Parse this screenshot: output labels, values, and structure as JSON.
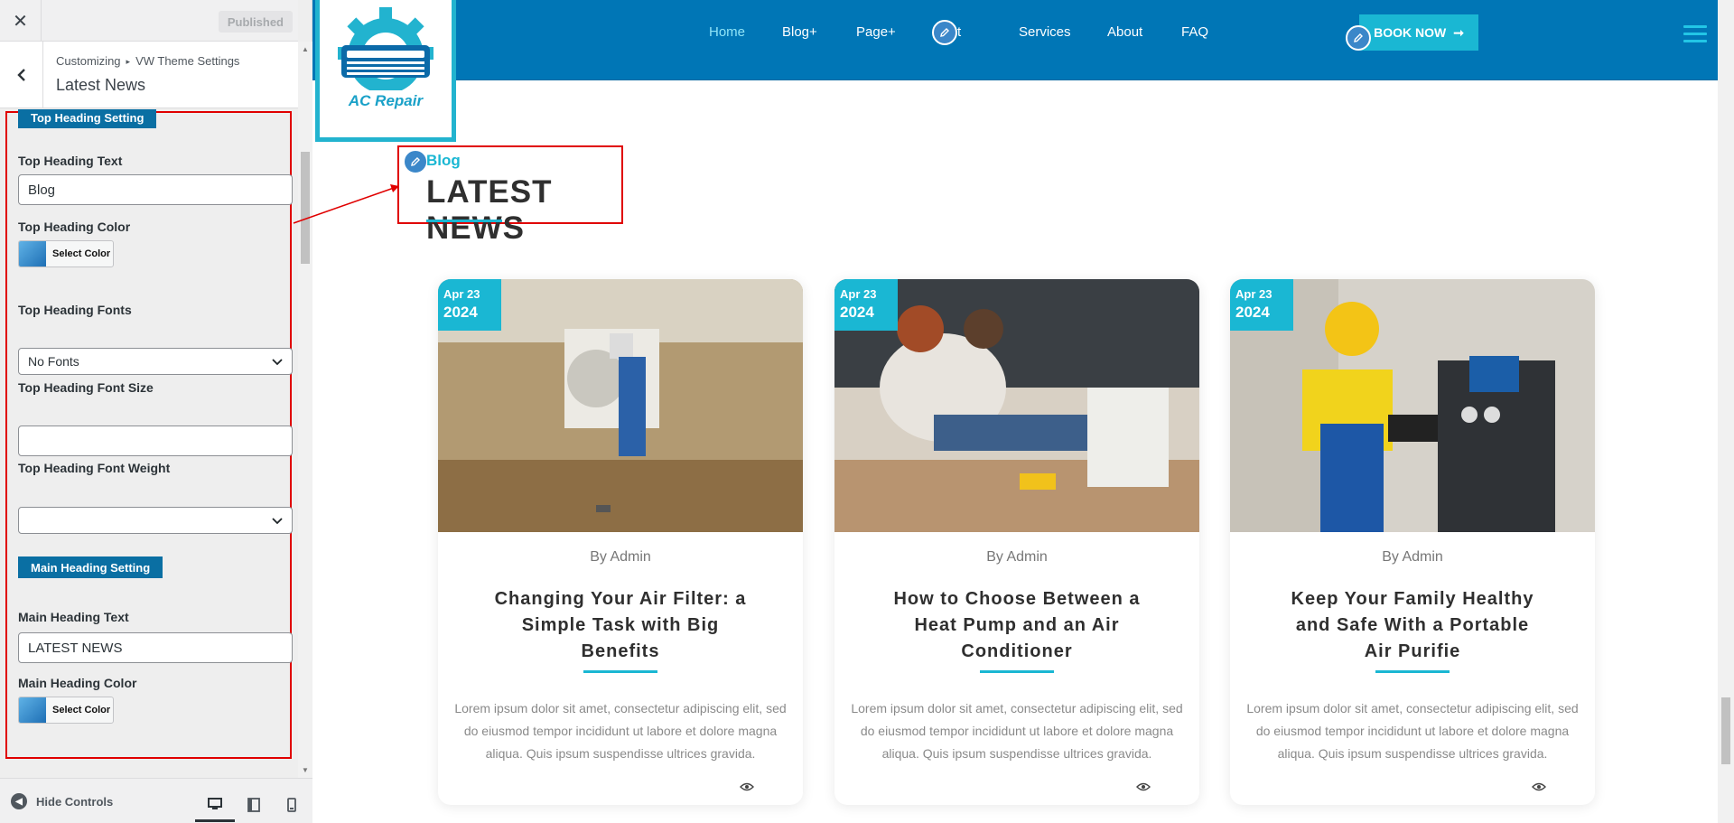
{
  "customizer": {
    "published_label": "Published",
    "breadcrumb": [
      "Customizing",
      "VW Theme Settings"
    ],
    "breadcrumb_sep": "▸",
    "section_title": "Latest News",
    "top_heading_setting_label": "Top Heading Setting",
    "top_heading_text_label": "Top Heading Text",
    "top_heading_text_value": "Blog",
    "top_heading_color_label": "Top Heading Color",
    "select_color_label": "Select Color",
    "top_heading_fonts_label": "Top Heading Fonts",
    "top_heading_fonts_value": "No Fonts",
    "top_heading_font_size_label": "Top Heading Font Size",
    "top_heading_font_size_value": "",
    "top_heading_font_weight_label": "Top Heading Font Weight",
    "top_heading_font_weight_value": "",
    "main_heading_setting_label": "Main Heading Setting",
    "main_heading_text_label": "Main Heading Text",
    "main_heading_text_value": "LATEST NEWS",
    "main_heading_color_label": "Main Heading Color",
    "hide_controls_label": "Hide Controls",
    "devices": [
      "desktop-icon",
      "tablet-icon",
      "mobile-icon"
    ]
  },
  "site": {
    "logo_text": "AC Repair",
    "nav": [
      "Home",
      "Blog+",
      "Page+",
      "Contact",
      "Services",
      "About",
      "FAQ"
    ],
    "nav_visible_contact": "tact",
    "book_now_label": "BOOK NOW",
    "section_top_heading": "Blog",
    "section_main_heading": "LATEST NEWS",
    "posts": [
      {
        "date_md": "Apr 23",
        "date_year": "2024",
        "author": "By Admin",
        "title": "Changing Your Air Filter: a Simple Task with Big Benefits",
        "excerpt": "Lorem ipsum dolor sit amet, consectetur adipiscing elit, sed do eiusmod tempor incididunt ut labore et dolore magna aliqua. Quis ipsum suspendisse ultrices gravida."
      },
      {
        "date_md": "Apr 23",
        "date_year": "2024",
        "author": "By Admin",
        "title": "How to Choose Between a Heat Pump and an Air Conditioner",
        "excerpt": "Lorem ipsum dolor sit amet, consectetur adipiscing elit, sed do eiusmod tempor incididunt ut labore et dolore magna aliqua. Quis ipsum suspendisse ultrices gravida."
      },
      {
        "date_md": "Apr 23",
        "date_year": "2024",
        "author": "By Admin",
        "title": "Keep Your Family Healthy and Safe With a Portable Air Purifie",
        "excerpt": "Lorem ipsum dolor sit amet, consectetur adipiscing elit, sed do eiusmod tempor incididunt ut labore et dolore magna aliqua. Quis ipsum suspendisse ultrices gravida."
      }
    ]
  },
  "colors": {
    "nav_bg": "#0076b6",
    "accent": "#1ab7d3",
    "highlight_border": "#e00000",
    "setting_badge": "#0a6fa3"
  }
}
